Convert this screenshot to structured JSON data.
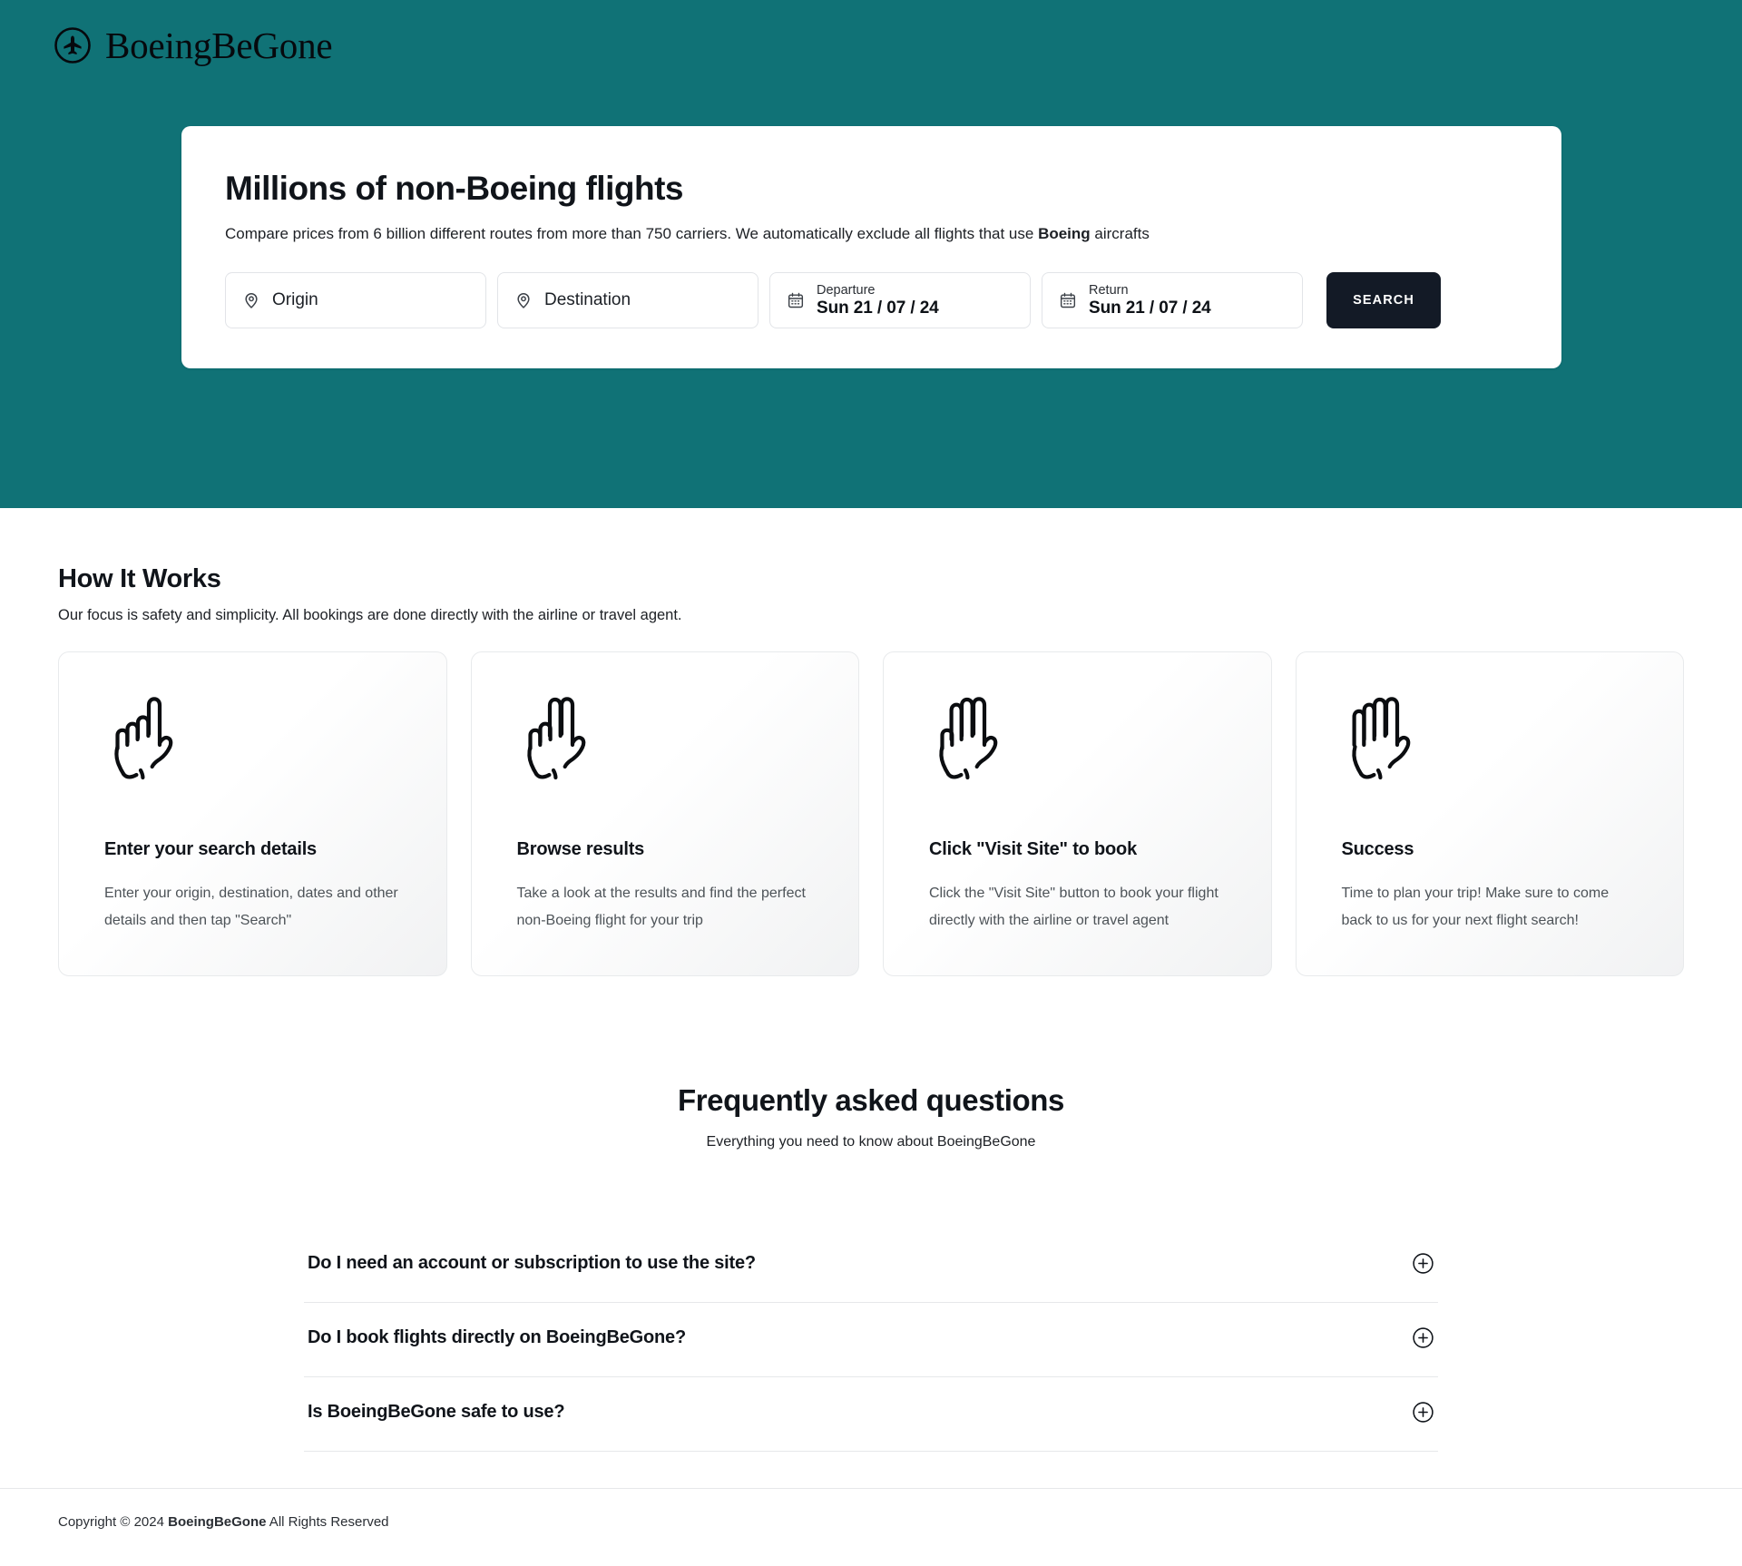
{
  "brand": {
    "name": "BoeingBeGone",
    "logo_icon": "plane-in-circle-icon",
    "accent_color": "#107276"
  },
  "hero": {
    "title": "Millions of non-Boeing flights",
    "subtitle_before": "Compare prices from 6 billion different routes from more than 750 carriers. We automatically exclude all flights that use ",
    "subtitle_bold": "Boeing",
    "subtitle_after": " aircrafts",
    "search": {
      "origin": {
        "placeholder": "Origin",
        "value": "",
        "icon": "map-pin-icon"
      },
      "destination": {
        "placeholder": "Destination",
        "value": "",
        "icon": "map-pin-icon"
      },
      "departure": {
        "label": "Departure",
        "value": "Sun 21 / 07 / 24",
        "icon": "calendar-icon"
      },
      "return": {
        "label": "Return",
        "value": "Sun 21 / 07 / 24",
        "icon": "calendar-icon"
      },
      "search_button": "SEARCH",
      "button_color": "#131a26"
    }
  },
  "how_it_works": {
    "title": "How It Works",
    "subtitle": "Our focus is safety and simplicity. All bookings are done directly with the airline or travel agent.",
    "cards": [
      {
        "icon": "hand-one-finger-icon",
        "title": "Enter your search details",
        "desc": "Enter your origin, destination, dates and other details and then tap \"Search\""
      },
      {
        "icon": "hand-two-fingers-icon",
        "title": "Browse results",
        "desc": "Take a look at the results and find the perfect non-Boeing flight for your trip"
      },
      {
        "icon": "hand-three-fingers-icon",
        "title": "Click \"Visit Site\" to book",
        "desc": "Click the \"Visit Site\" button to book your flight directly with the airline or travel agent"
      },
      {
        "icon": "hand-four-fingers-icon",
        "title": "Success",
        "desc": "Time to plan your trip! Make sure to come back to us for your next flight search!"
      }
    ]
  },
  "faq": {
    "title": "Frequently asked questions",
    "subtitle": "Everything you need to know about BoeingBeGone",
    "expand_icon": "plus-circle-icon",
    "items": [
      {
        "question": "Do I need an account or subscription to use the site?"
      },
      {
        "question": "Do I book flights directly on BoeingBeGone?"
      },
      {
        "question": "Is BoeingBeGone safe to use?"
      }
    ]
  },
  "footer": {
    "copyright_prefix": "Copyright © 2024 ",
    "brand": "BoeingBeGone",
    "copyright_suffix": " All Rights Reserved"
  }
}
